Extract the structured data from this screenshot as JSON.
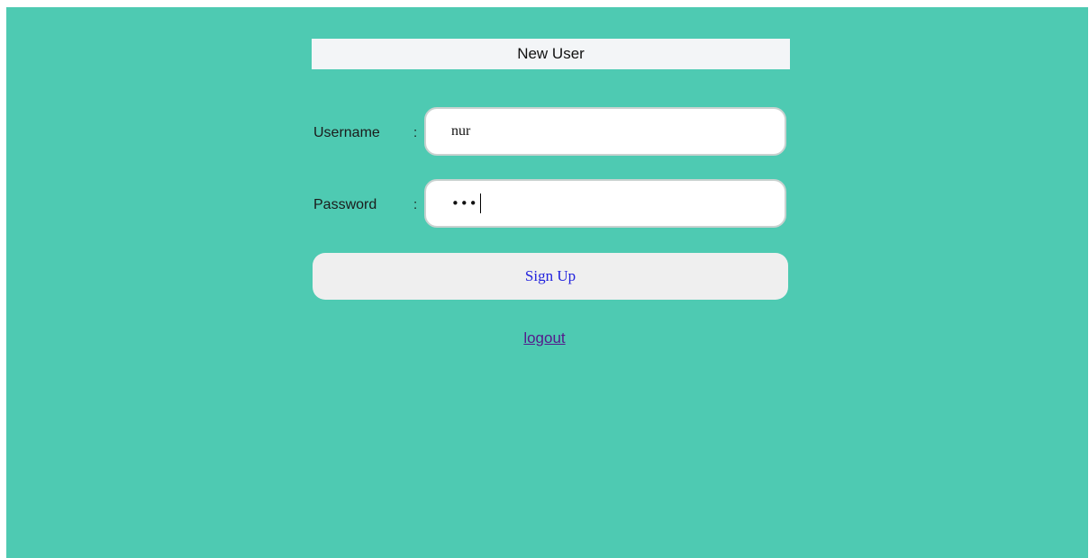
{
  "form": {
    "title": "New User",
    "username": {
      "label": "Username",
      "separator": ":",
      "value": "nur"
    },
    "password": {
      "label": "Password",
      "separator": ":",
      "masked_value": "•••"
    },
    "submit_label": "Sign Up"
  },
  "links": {
    "logout_label": "logout"
  },
  "colors": {
    "background": "#4ecab2",
    "title_bar": "#f3f5f7",
    "button": "#efefef",
    "button_text": "#2222dd",
    "visited_link": "#551a8b"
  }
}
